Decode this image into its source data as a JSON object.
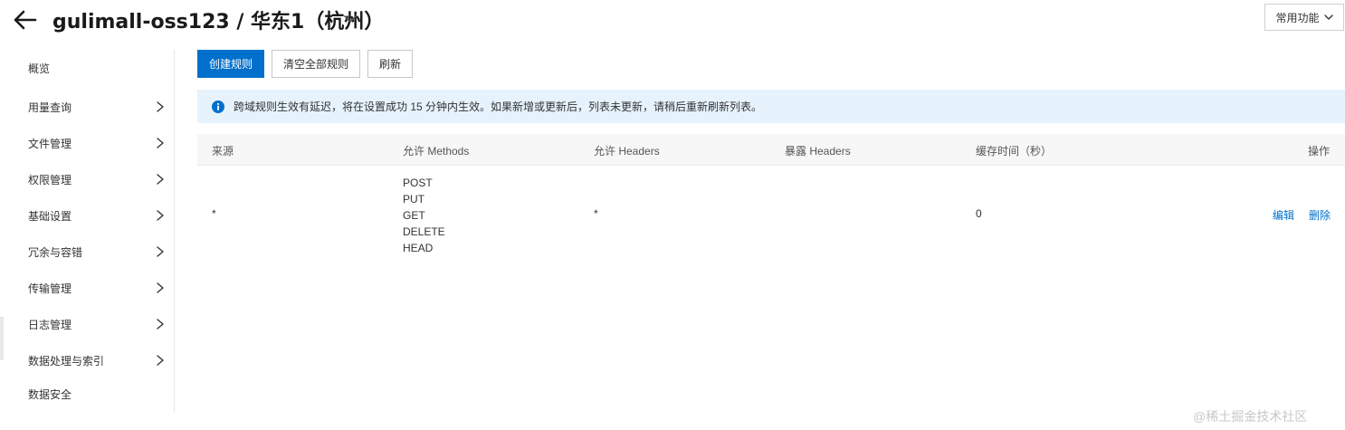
{
  "header": {
    "title": "gulimall-oss123 / 华东1（杭州）",
    "common_functions_label": "常用功能"
  },
  "sidebar": {
    "items": [
      {
        "label": "概览",
        "has_arrow": false
      },
      {
        "label": "用量查询",
        "has_arrow": true
      },
      {
        "label": "文件管理",
        "has_arrow": true
      },
      {
        "label": "权限管理",
        "has_arrow": true
      },
      {
        "label": "基础设置",
        "has_arrow": true
      },
      {
        "label": "冗余与容错",
        "has_arrow": true
      },
      {
        "label": "传输管理",
        "has_arrow": true
      },
      {
        "label": "日志管理",
        "has_arrow": true
      },
      {
        "label": "数据处理与索引",
        "has_arrow": true
      },
      {
        "label": "数据安全",
        "has_arrow": false
      }
    ]
  },
  "toolbar": {
    "create_label": "创建规则",
    "clear_label": "清空全部规则",
    "refresh_label": "刷新"
  },
  "notice": {
    "text": "跨域规则生效有延迟，将在设置成功 15 分钟内生效。如果新增或更新后，列表未更新，请稍后重新刷新列表。"
  },
  "table": {
    "columns": {
      "source": "来源",
      "methods": "允许 Methods",
      "allow_headers": "允许 Headers",
      "expose_headers": "暴露 Headers",
      "cache_time": "缓存时间（秒）",
      "actions": "操作"
    },
    "rows": [
      {
        "source": "*",
        "methods": [
          "POST",
          "PUT",
          "GET",
          "DELETE",
          "HEAD"
        ],
        "allow_headers": "*",
        "expose_headers": "",
        "cache_time": "0",
        "edit_label": "编辑",
        "delete_label": "删除"
      }
    ]
  },
  "watermark": "@稀土掘金技术社区",
  "colors": {
    "primary": "#0070cc",
    "notice_bg": "#e6f3fd",
    "table_header_bg": "#f7f7f7"
  },
  "icons": {
    "back": "arrow-left-icon",
    "title_dropdown": "chevron-down-icon",
    "common_dropdown": "chevron-down-icon",
    "sidebar_arrow": "chevron-right-icon",
    "notice": "info-icon"
  }
}
